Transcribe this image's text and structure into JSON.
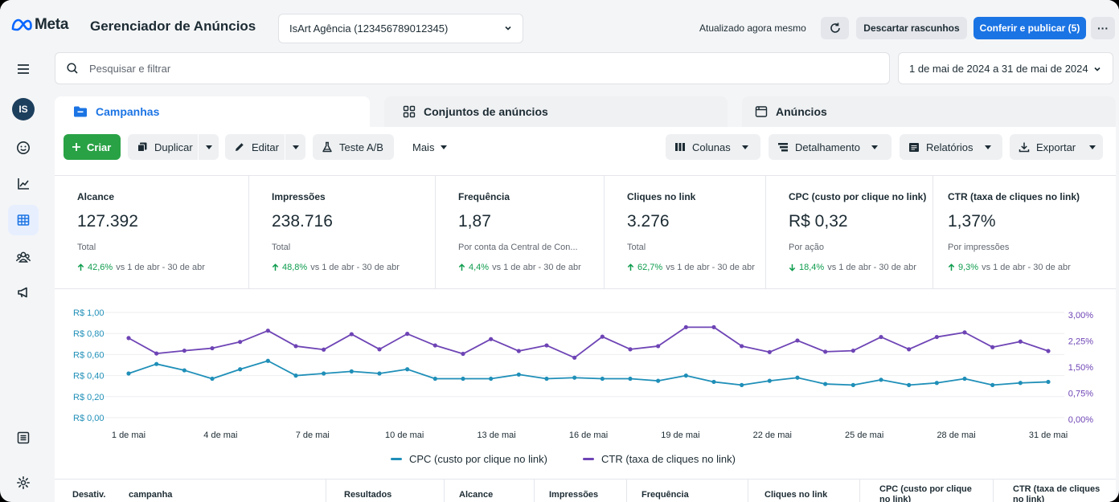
{
  "brand": {
    "logo_text": "Meta",
    "app_title": "Gerenciador de Anúncios"
  },
  "header": {
    "account": "IsArt Agência (123456789012345)",
    "updated": "Atualizado agora mesmo",
    "discard_label": "Descartar rascunhos",
    "publish_label": "Conferir e publicar (5)",
    "more_label": "···"
  },
  "sidebar": {
    "avatar_initials": "IS",
    "items": [
      "menu-icon",
      "avatar",
      "emoji-icon",
      "chart-icon",
      "table-icon",
      "audience-icon",
      "megaphone-icon",
      "list-icon",
      "gear-icon"
    ]
  },
  "search": {
    "placeholder": "Pesquisar e filtrar",
    "value": ""
  },
  "date_range": "1 de mai de 2024 a 31 de mai de 2024",
  "tabs": [
    {
      "label": "Campanhas"
    },
    {
      "label": "Conjuntos de anúncios"
    },
    {
      "label": "Anúncios"
    }
  ],
  "toolbar": {
    "create": "Criar",
    "duplicate": "Duplicar",
    "edit": "Editar",
    "ab_test": "Teste A/B",
    "more": "Mais",
    "columns": "Colunas",
    "breakdown": "Detalhamento",
    "reports": "Relatórios",
    "export": "Exportar"
  },
  "metrics": [
    {
      "label": "Alcance",
      "value": "127.392",
      "sub": "Total",
      "change": "42,6%",
      "dir": "up",
      "compare": "vs 1 de abr - 30 de abr"
    },
    {
      "label": "Impressões",
      "value": "238.716",
      "sub": "Total",
      "change": "48,8%",
      "dir": "up",
      "compare": "vs 1 de abr - 30 de abr"
    },
    {
      "label": "Frequência",
      "value": "1,87",
      "sub": "Por conta da Central de Con...",
      "change": "4,4%",
      "dir": "up",
      "compare": "vs 1 de abr - 30 de abr"
    },
    {
      "label": "Cliques no link",
      "value": "3.276",
      "sub": "Total",
      "change": "62,7%",
      "dir": "up",
      "compare": "vs 1 de abr - 30 de abr"
    },
    {
      "label": "CPC (custo por clique no link)",
      "value": "R$ 0,32",
      "sub": "Por ação",
      "change": "18,4%",
      "dir": "down",
      "compare": "vs 1 de abr - 30 de abr"
    },
    {
      "label": "CTR (taxa de cliques no link)",
      "value": "1,37%",
      "sub": "Por impressões",
      "change": "9,3%",
      "dir": "up",
      "compare": "vs 1 de abr - 30 de abr"
    }
  ],
  "colors": {
    "cpc": "#1f8fb8",
    "ctr": "#6e44b5",
    "accent": "#1b74e4",
    "create": "#29a245",
    "up": "#0d9c4d"
  },
  "chart_data": {
    "type": "line",
    "x": [
      "1 de mai",
      "2 de mai",
      "3 de mai",
      "4 de mai",
      "5 de mai",
      "6 de mai",
      "7 de mai",
      "8 de mai",
      "9 de mai",
      "10 de mai",
      "11 de mai",
      "12 de mai",
      "13 de mai",
      "14 de mai",
      "15 de mai",
      "16 de mai",
      "17 de mai",
      "18 de mai",
      "19 de mai",
      "20 de mai",
      "21 de mai",
      "22 de mai",
      "23 de mai",
      "24 de mai",
      "25 de mai",
      "26 de mai",
      "27 de mai",
      "28 de mai",
      "29 de mai",
      "30 de mai",
      "31 de mai"
    ],
    "x_tick_labels": [
      "1 de mai",
      "4 de mai",
      "7 de mai",
      "10 de mai",
      "13 de mai",
      "16 de mai",
      "19 de mai",
      "22 de mai",
      "25 de mai",
      "28 de mai",
      "31 de mai"
    ],
    "left_axis": {
      "ticks": [
        "R$ 0,00",
        "R$ 0,20",
        "R$ 0,40",
        "R$ 0,60",
        "R$ 0,80",
        "R$ 1,00"
      ],
      "ylim": [
        0,
        1.0
      ]
    },
    "right_axis": {
      "ticks": [
        "0,00%",
        "0,75%",
        "1,50%",
        "2,25%",
        "3,00%"
      ],
      "ylim": [
        0,
        3.0
      ]
    },
    "grid": true,
    "legend_position": "bottom-center",
    "series": [
      {
        "name": "CPC (custo por clique no link)",
        "axis": "left",
        "values": [
          0.42,
          0.51,
          0.45,
          0.37,
          0.46,
          0.54,
          0.4,
          0.42,
          0.44,
          0.42,
          0.46,
          0.37,
          0.37,
          0.37,
          0.41,
          0.37,
          0.38,
          0.37,
          0.37,
          0.35,
          0.4,
          0.34,
          0.31,
          0.35,
          0.38,
          0.32,
          0.31,
          0.36,
          0.31,
          0.33,
          0.37,
          0.31,
          0.33,
          0.34
        ]
      },
      {
        "name": "CTR (taxa de cliques no link)",
        "axis": "right",
        "values": [
          2.27,
          1.83,
          1.91,
          1.98,
          2.16,
          2.48,
          2.04,
          1.94,
          2.38,
          1.95,
          2.39,
          2.06,
          1.82,
          2.24,
          1.9,
          2.06,
          1.71,
          2.31,
          1.95,
          2.04,
          2.58,
          2.58,
          2.04,
          1.87,
          2.2,
          1.88,
          1.91,
          2.3,
          1.95,
          2.3,
          2.43,
          2.01,
          2.17,
          1.9
        ]
      }
    ]
  },
  "table": {
    "columns": [
      "Desativ.",
      "campanha",
      "Resultados",
      "Alcance",
      "Impressões",
      "Frequência",
      "Cliques no link",
      "CPC (custo por clique no link)",
      "CTR (taxa de cliques no link)"
    ]
  }
}
